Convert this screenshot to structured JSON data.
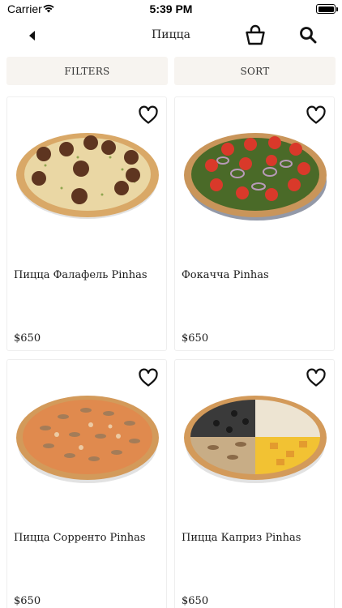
{
  "status": {
    "carrier": "Carrier",
    "time": "5:39 PM"
  },
  "nav": {
    "title": "Пицца",
    "icons": [
      "back-arrow-icon",
      "shopping-basket-icon",
      "search-icon"
    ]
  },
  "toolbar": {
    "filters_label": "FILTERS",
    "sort_label": "SORT"
  },
  "products": [
    {
      "name": "Пицца Фалафель Pinhas",
      "price": "$650",
      "style": "falafel"
    },
    {
      "name": "Фокачча Pinhas",
      "price": "$650",
      "style": "pesto"
    },
    {
      "name": "Пицца Сорренто Pinhas",
      "price": "$650",
      "style": "mushroom"
    },
    {
      "name": "Пицца Каприз Pinhas",
      "price": "$650",
      "style": "quattro"
    }
  ],
  "colors": {
    "pill_bg": "#f7f4f0",
    "card_border": "#eeeeee",
    "crust": "#d9a867"
  }
}
